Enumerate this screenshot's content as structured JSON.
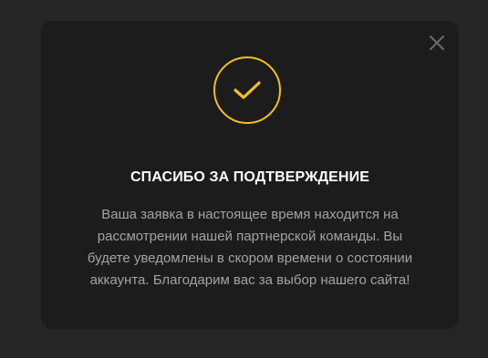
{
  "modal": {
    "title": "СПАСИБО ЗА ПОДТВЕРЖДЕНИЕ",
    "message_lines": [
      "Ваша заявка в настоящее время находится на",
      "рассмотрении нашей партнерской команды. Вы",
      "будете уведомлены в скором времени о состоянии",
      "аккаунта. Благодарим вас за выбор нашего сайта!"
    ],
    "icons": {
      "close": "close-icon",
      "success": "checkmark-icon"
    }
  },
  "colors": {
    "page_background": "#262626",
    "modal_background": "#1c1c1c",
    "accent": "#f5be1e",
    "title": "#ffffff",
    "body_text": "#a3a3a3",
    "close_icon": "#6b6b6b"
  }
}
